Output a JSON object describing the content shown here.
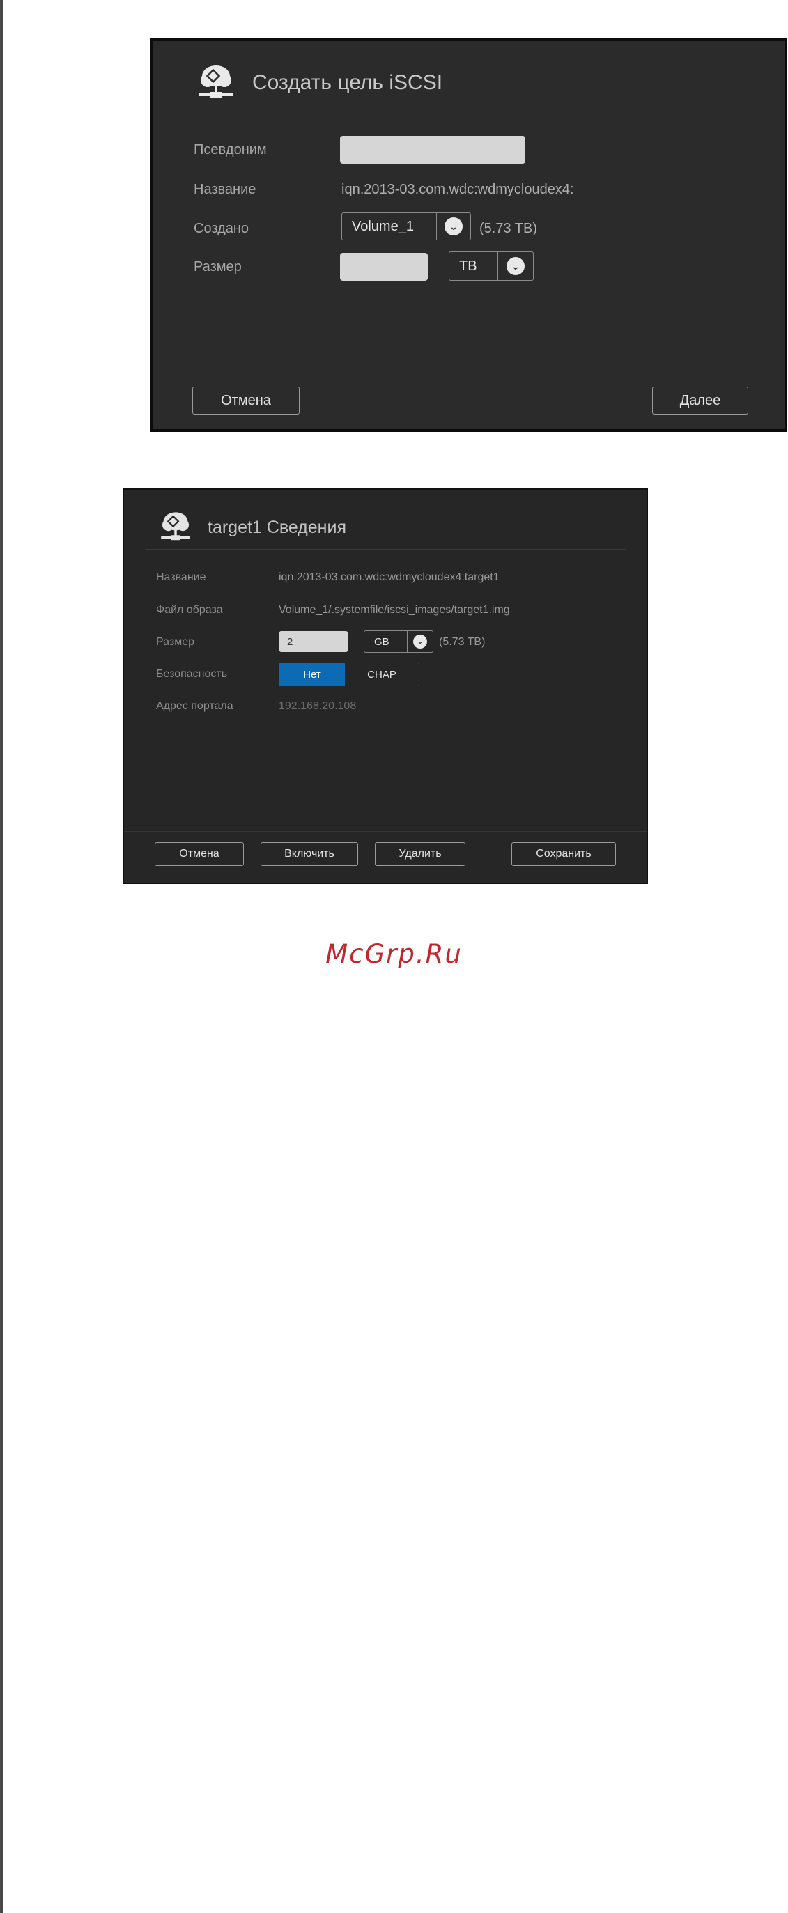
{
  "create_dialog": {
    "title": "Создать цель iSCSI",
    "icon": "cloud-network-icon",
    "fields": {
      "alias_label": "Псевдоним",
      "alias_value": "",
      "name_label": "Название",
      "name_value": "iqn.2013-03.com.wdc:wdmycloudex4:",
      "created_label": "Создано",
      "volume_value": "Volume_1",
      "volume_capacity": "(5.73 TB)",
      "size_label": "Размер",
      "size_value": "",
      "size_unit": "TB"
    },
    "buttons": {
      "cancel": "Отмена",
      "next": "Далее"
    }
  },
  "details_dialog": {
    "title": "target1 Сведения",
    "icon": "cloud-network-icon",
    "name_label": "Название",
    "name_value": "iqn.2013-03.com.wdc:wdmycloudex4:target1",
    "image_file_label": "Файл образа",
    "image_file_value": "Volume_1/.systemfile/iscsi_images/target1.img",
    "size_label": "Размер",
    "size_value": "2",
    "size_unit": "GB",
    "size_capacity": "(5.73 TB)",
    "security_label": "Безопасность",
    "security_options": [
      "Нет",
      "CHAP"
    ],
    "security_selected": "Нет",
    "portal_label": "Адрес портала",
    "portal_value": "192.168.20.108",
    "buttons": {
      "cancel": "Отмена",
      "enable": "Включить",
      "delete": "Удалить",
      "save": "Сохранить"
    }
  },
  "watermark": "McGrp.Ru",
  "colors": {
    "dialog_bg": "#2b2b2b",
    "accent": "#0b6bb5",
    "watermark": "#c0282d"
  }
}
